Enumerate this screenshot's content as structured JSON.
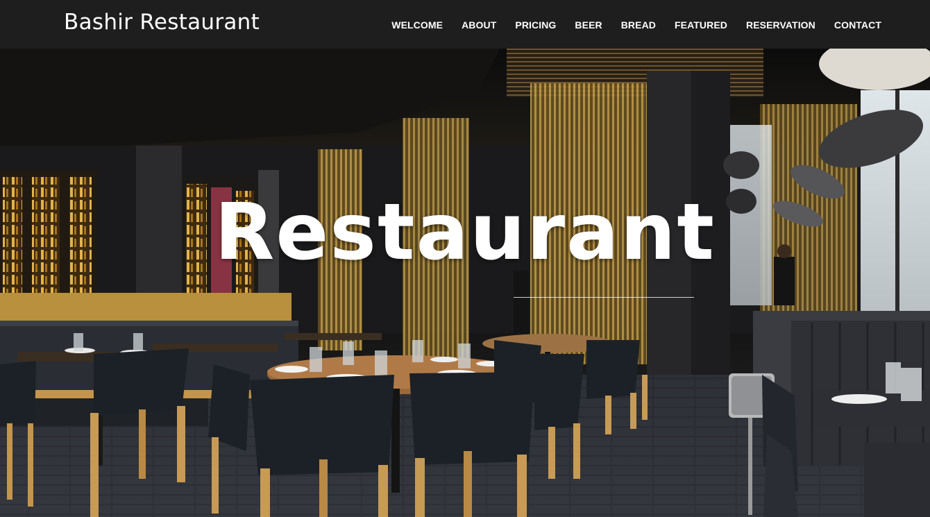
{
  "brand": {
    "name": "Bashir Restaurant"
  },
  "nav": {
    "items": [
      {
        "label": "WELCOME"
      },
      {
        "label": "ABOUT"
      },
      {
        "label": "PRICING"
      },
      {
        "label": "BEER"
      },
      {
        "label": "BREAD"
      },
      {
        "label": "FEATURED"
      },
      {
        "label": "RESERVATION"
      },
      {
        "label": "CONTACT"
      }
    ]
  },
  "hero": {
    "title": "Restaurant",
    "image": "restaurant-interior-photo"
  },
  "colors": {
    "navbar_bg": "#1e1e1e",
    "nav_text": "#ffffff",
    "hero_title": "#ffffff",
    "wood_accent": "#b8903e",
    "chair_dark": "#1c2128"
  }
}
